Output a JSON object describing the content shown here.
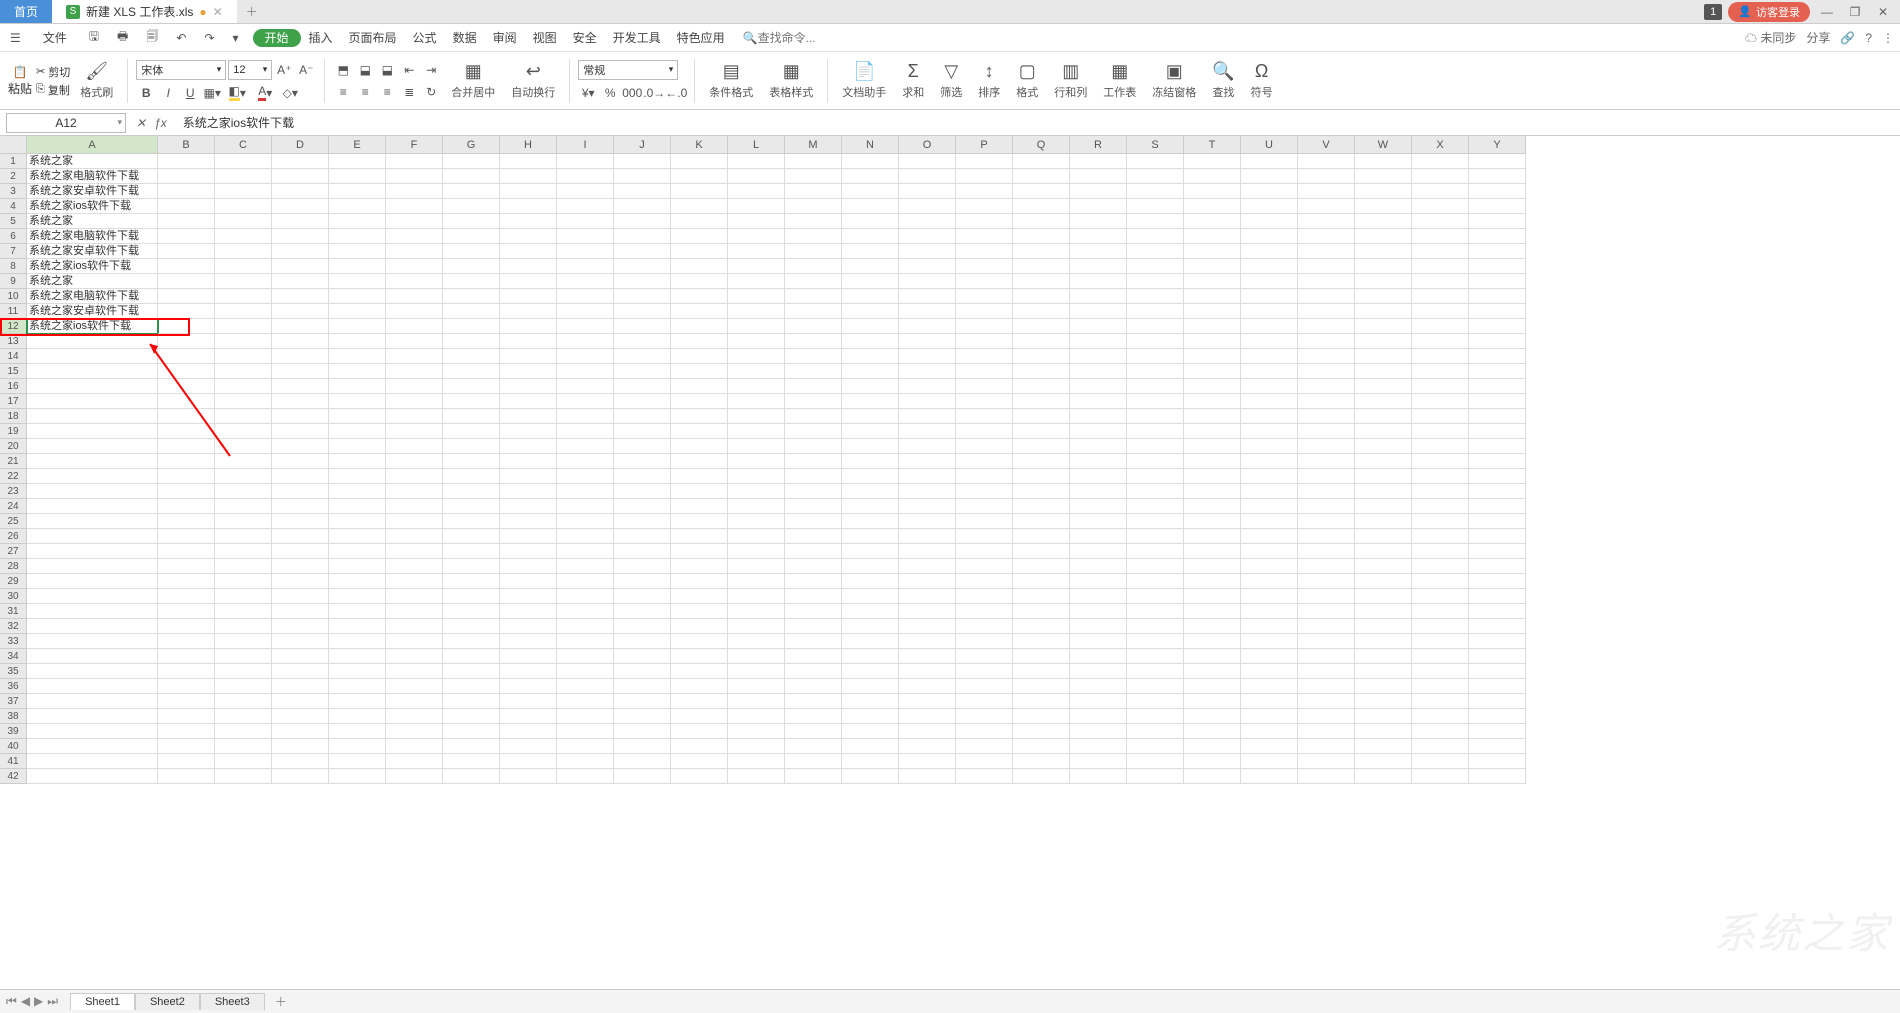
{
  "tabs": {
    "home": "首页",
    "file": "新建 XLS 工作表.xls"
  },
  "titleRight": {
    "count": "1",
    "login": "访客登录"
  },
  "menu": {
    "fileBtn": "文件",
    "items": [
      "开始",
      "插入",
      "页面布局",
      "公式",
      "数据",
      "审阅",
      "视图",
      "安全",
      "开发工具",
      "特色应用"
    ],
    "searchPlaceholder": "查找命令...",
    "sync": "未同步",
    "share": "分享"
  },
  "ribbon": {
    "paste": "粘贴",
    "cut": "剪切",
    "copy": "复制",
    "format": "格式刷",
    "fontName": "宋体",
    "fontSize": "12",
    "merge": "合并居中",
    "wrap": "自动换行",
    "numFmt": "常规",
    "condFmt": "条件格式",
    "tblFmt": "表格样式",
    "docAsst": "文档助手",
    "sum": "求和",
    "filter": "筛选",
    "sort": "排序",
    "fmt": "格式",
    "rowcol": "行和列",
    "sheet": "工作表",
    "freeze": "冻结窗格",
    "find": "查找",
    "symbol": "符号"
  },
  "nameBox": "A12",
  "formula": "系统之家ios软件下载",
  "columns": [
    "A",
    "B",
    "C",
    "D",
    "E",
    "F",
    "G",
    "H",
    "I",
    "J",
    "K",
    "L",
    "M",
    "N",
    "O",
    "P",
    "Q",
    "R",
    "S",
    "T",
    "U",
    "V",
    "W",
    "X",
    "Y"
  ],
  "cellsA": [
    "系统之家",
    "系统之家电脑软件下载",
    "系统之家安卓软件下载",
    "系统之家ios软件下载",
    "系统之家",
    "系统之家电脑软件下载",
    "系统之家安卓软件下载",
    "系统之家ios软件下载",
    "系统之家",
    "系统之家电脑软件下载",
    "系统之家安卓软件下载",
    "系统之家ios软件下载"
  ],
  "selectedRow": 12,
  "rowCount": 42,
  "sheets": [
    "Sheet1",
    "Sheet2",
    "Sheet3"
  ]
}
